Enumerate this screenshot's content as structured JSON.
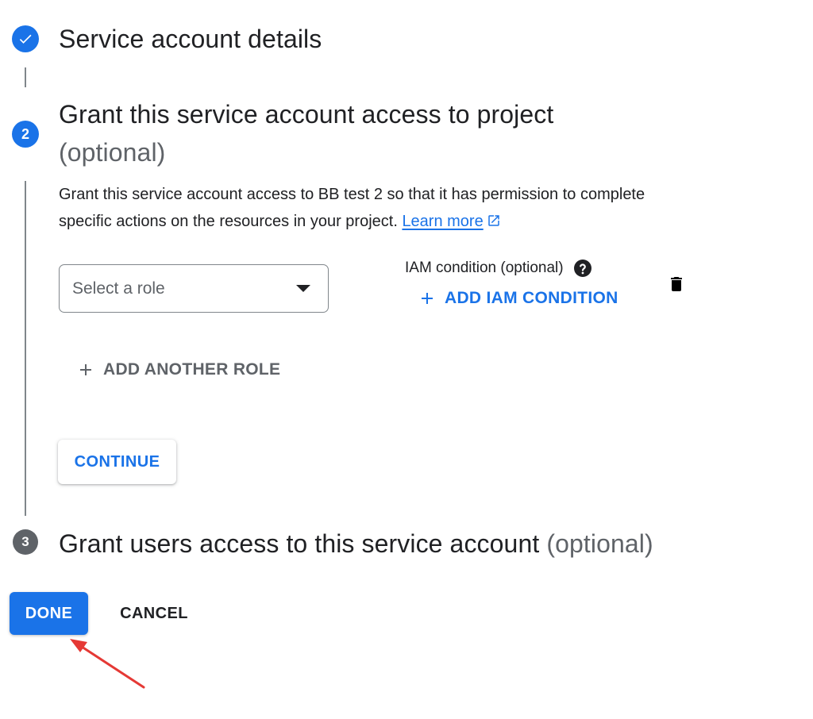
{
  "steps": [
    {
      "number": "1",
      "title": "Service account details",
      "optional": "",
      "status": "complete"
    },
    {
      "number": "2",
      "title": "Grant this service account access to project",
      "optional": "(optional)",
      "status": "active"
    },
    {
      "number": "3",
      "title": "Grant users access to this service account",
      "optional": "(optional)",
      "status": "pending"
    }
  ],
  "grant_access": {
    "description": "Grant this service account access to BB test 2 so that it has permission to complete specific actions on the resources in your project.",
    "learn_more": "Learn more",
    "role_select": {
      "placeholder": "Select a role",
      "value": ""
    },
    "iam_condition_label": "IAM condition (optional)",
    "add_iam_condition": "ADD IAM CONDITION",
    "add_another_role": "ADD ANOTHER ROLE",
    "continue": "CONTINUE"
  },
  "footer": {
    "done": "DONE",
    "cancel": "CANCEL"
  },
  "colors": {
    "accent": "#1a73e8",
    "annotation_arrow": "#e53935",
    "pending_step": "#5f6368"
  },
  "icons": [
    "check-icon",
    "external-link-icon",
    "help-icon",
    "plus-icon",
    "delete-icon",
    "dropdown-caret-icon",
    "annotation-arrow"
  ]
}
